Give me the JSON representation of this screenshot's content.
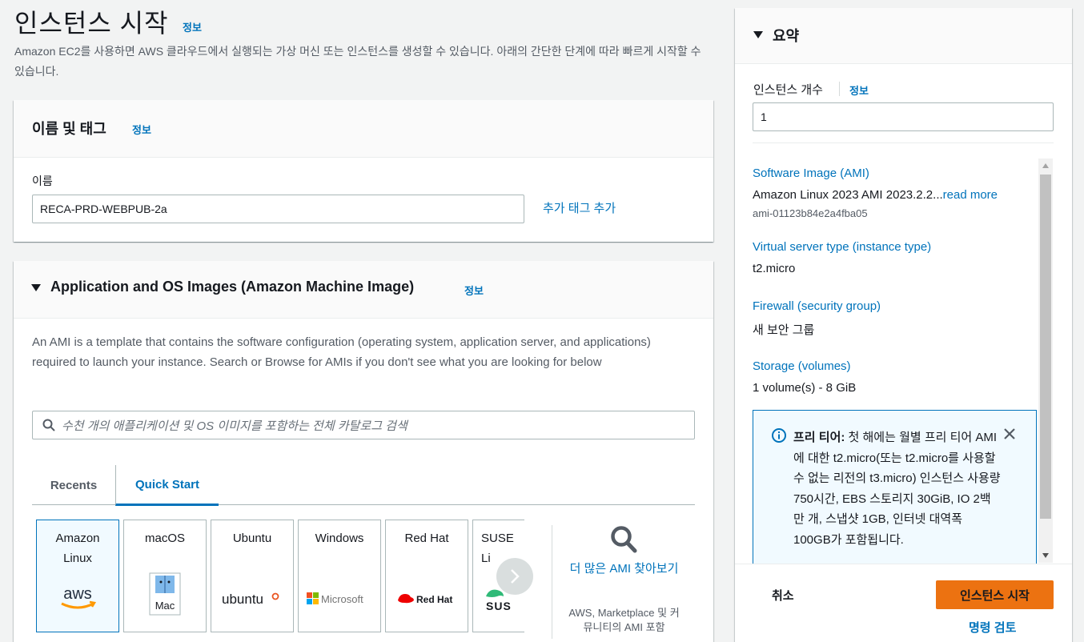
{
  "page": {
    "title": "인스턴스 시작",
    "info": "정보",
    "description": "Amazon EC2를 사용하면 AWS 클라우드에서 실행되는 가상 머신 또는 인스턴스를 생성할 수 있습니다. 아래의 간단한 단계에 따라 빠르게 시작할 수 있습니다."
  },
  "name_tags": {
    "title": "이름 및 태그",
    "info": "정보",
    "name_label": "이름",
    "name_value": "RECA-PRD-WEBPUB-2a",
    "add_tag": "추가 태그 추가"
  },
  "ami": {
    "title": "Application and OS Images (Amazon Machine Image)",
    "info": "정보",
    "description": "An AMI is a template that contains the software configuration (operating system, application server, and applications) required to launch your instance. Search or Browse for AMIs if you don't see what you are looking for below",
    "search_placeholder": "수천 개의 애플리케이션 및 OS 이미지를 포함하는 전체 카탈로그 검색",
    "tabs": [
      {
        "label": "Recents",
        "active": false
      },
      {
        "label": "Quick Start",
        "active": true
      }
    ],
    "os_cards": [
      {
        "label": "Amazon Linux",
        "logo": "aws",
        "selected": true
      },
      {
        "label": "macOS",
        "logo": "Mac",
        "selected": false
      },
      {
        "label": "Ubuntu",
        "logo": "ubuntu",
        "selected": false
      },
      {
        "label": "Windows",
        "logo": "Microsoft",
        "selected": false
      },
      {
        "label": "Red Hat",
        "logo": "Red Hat",
        "selected": false
      },
      {
        "label": "SUSE Li",
        "logo": "SUS",
        "selected": false
      }
    ],
    "browse_link": "더 많은 AMI 찾아보기",
    "browse_sub": "AWS, Marketplace 및 커뮤니티의 AMI 포함"
  },
  "summary": {
    "title": "요약",
    "count_label": "인스턴스 개수",
    "info": "정보",
    "count_value": "1",
    "items": [
      {
        "key": "Software Image (AMI)",
        "value": "Amazon Linux 2023 AMI 2023.2.2...",
        "more": "read more",
        "sub": "ami-01123b84e2a4fba05"
      },
      {
        "key": "Virtual server type (instance type)",
        "value": "t2.micro"
      },
      {
        "key": "Firewall (security group)",
        "value": "새 보안 그룹"
      },
      {
        "key": "Storage (volumes)",
        "value": "1 volume(s) - 8 GiB"
      }
    ],
    "free_tier": {
      "bold": "프리 티어:",
      "text": " 첫 해에는 월별 프리 티어 AMI에 대한 t2.micro(또는 t2.micro를 사용할 수 없는 리전의 t3.micro) 인스턴스 사용량 750시간, EBS 스토리지 30GiB, IO 2백만 개, 스냅샷 1GB, 인터넷 대역폭 100GB가 포함됩니다."
    },
    "cancel": "취소",
    "launch": "인스턴스 시작",
    "review": "명령 검토"
  },
  "colors": {
    "link": "#0073bb",
    "primary_button": "#ec7211",
    "page_bg": "#f2f3f3"
  }
}
